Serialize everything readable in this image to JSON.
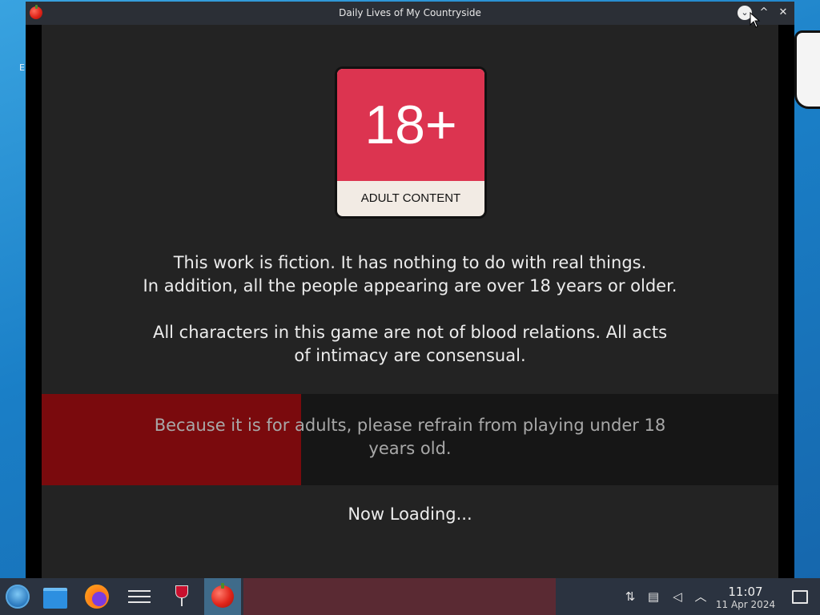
{
  "desktop": {
    "label": "E"
  },
  "window": {
    "title": "Daily Lives of My Countryside",
    "app_icon": "tomato-icon",
    "controls": {
      "minimize": "⌄",
      "maximize": "^",
      "close": "✕"
    }
  },
  "game": {
    "badge": {
      "main": "18+",
      "caption": "ADULT CONTENT",
      "color": "#dc3450"
    },
    "para1": {
      "line1": "This work is fiction. It has nothing to do with real things.",
      "line2": "In addition, all the people appearing are over 18 years or older."
    },
    "para2": {
      "line1": "All characters in this game are not of blood relations. All acts",
      "line2": "of intimacy are consensual."
    },
    "warning": {
      "line1": "Because it is for adults, please refrain from playing under 18",
      "line2": "years old.",
      "progress_fraction": 0.352,
      "progress_color": "#7a0a0d"
    },
    "loading_text": "Now Loading..."
  },
  "taskbar": {
    "apps": [
      "start-icon",
      "file-manager-icon",
      "firefox-icon",
      "settings-icon",
      "wine-icon",
      "tomato-icon"
    ],
    "tray": [
      "network-icon",
      "clipboard-icon",
      "muted-speaker-icon",
      "chevron-up-icon"
    ],
    "clock": {
      "time": "11:07",
      "date": "11 Apr 2024"
    }
  }
}
